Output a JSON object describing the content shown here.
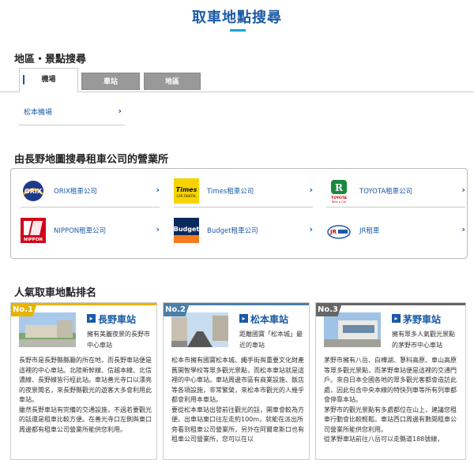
{
  "page": {
    "title": "取車地點搜尋",
    "area_heading": "地區・景點搜尋",
    "tabs": [
      {
        "label": "機場",
        "active": true
      },
      {
        "label": "車站",
        "active": false
      },
      {
        "label": "地區",
        "active": false
      }
    ],
    "location_item": "松本機場",
    "chevron": "›",
    "company_heading": "由長野地圖搜尋租車公司的營業所",
    "companies": [
      {
        "name": "ORIX租車公司",
        "logo_icon": "orix-logo-icon"
      },
      {
        "name": "Times租車公司",
        "logo_icon": "times-logo-icon"
      },
      {
        "name": "TOYOTA租車公司",
        "logo_icon": "toyota-logo-icon"
      },
      {
        "name": "NIPPON租車公司",
        "logo_icon": "nippon-logo-icon"
      },
      {
        "name": "Budget租車公司",
        "logo_icon": "budget-logo-icon"
      },
      {
        "name": "JR租車",
        "logo_icon": "jr-logo-icon"
      }
    ],
    "ranking_heading": "人氣取車地點排名",
    "ranking": [
      {
        "rank": "No.1",
        "color": "#e8b400",
        "name": "長野車站",
        "sub": "擁有美麗夜景的長野市中心車站",
        "body": "長野市是長野縣縣廳的所在地，而長野車站便是這裡的中心車站。北陸新幹線、信越本線、北信濃線、長野線皆行經此站。車站善光寺口以漂亮的夜景聞名，來長野縣觀光的遊客大多會利用此車站。\n雖然長野車站有完備的交通設施，不過若要觀光的話還是租車比較方便。在善光寺口左側與東口周邊都有租車公司營業所能供您利用。"
      },
      {
        "rank": "No.2",
        "color": "#4a7fa8",
        "name": "松本車站",
        "sub": "距離國寶「松本城」最近的車站",
        "body": "松本市擁有國寶松本城、繩手街與重要文化財產舊開智學校等眾多觀光景點，而松本車站就是這裡的中心車站。車站周邊市區有商業設施、飯店等各項設施，非常繁榮，來松本市觀光的人幾乎都會利用本車站。\n要從松本車站出發前往觀光的話，開車會較為方便。出車站東口往左走約100m，就能在派出所旁看到租車公司營業所，另外在阿爾卑斯口也有租車公司營業所，您可以在以"
      },
      {
        "rank": "No.3",
        "color": "#666666",
        "name": "茅野車站",
        "sub": "擁有眾多人氣觀光景點的茅野市中心車站",
        "body": "茅野市擁有八岳、白樺湖、蓼科高原、車山高原等眾多觀光景點，而茅野車站便是這裡的交通門戶。來自日本全國各地的眾多觀光客都會造訪此處，因此包含中央本線的特快列車等所有列車都會停靠本站。\n茅野市的觀光景點有多處都位在山上，建議您租車行動會比較輕鬆。車站西口周邊有數間租車公司營業所能供您利用。\n從茅野車站前往八岳可以走縣道188號線，"
      }
    ],
    "go_glyph": "▸"
  }
}
